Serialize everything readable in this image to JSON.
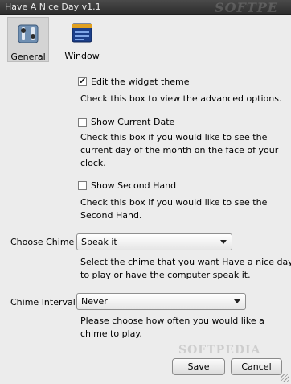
{
  "window": {
    "title": "Have A Nice Day v1.1",
    "watermark": "SOFTPE"
  },
  "toolbar": {
    "general_label": "General",
    "window_label": "Window"
  },
  "settings": {
    "widget_theme": {
      "label": "Edit the widget theme",
      "checked": true,
      "help": "Check this box to view the advanced options."
    },
    "current_date": {
      "label": "Show Current Date",
      "checked": false,
      "help_line1": "Check this box if you would like to see the",
      "help_line2": "current day of the month on the face of your",
      "help_line3": "clock."
    },
    "second_hand": {
      "label": "Show Second Hand",
      "checked": false,
      "help_line1": "Check this box if you would like to see the",
      "help_line2": "Second Hand."
    },
    "chime": {
      "label": "Choose Chime",
      "value": "Speak it",
      "help_line1": "Select the chime that you want Have a nice day",
      "help_line2": "to play or have the computer speak it."
    },
    "chime_interval": {
      "label": "Chime Interval:",
      "value": "Never",
      "help_line1": "Please choose how often you would like a",
      "help_line2": "chime to play."
    }
  },
  "buttons": {
    "save": "Save",
    "cancel": "Cancel"
  },
  "footer_watermark": "SOFTPEDIA"
}
